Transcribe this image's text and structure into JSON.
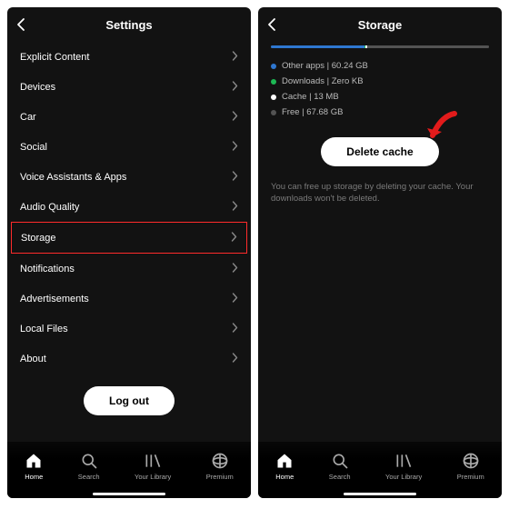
{
  "left": {
    "title": "Settings",
    "items": [
      {
        "label": "Explicit Content"
      },
      {
        "label": "Devices"
      },
      {
        "label": "Car"
      },
      {
        "label": "Social"
      },
      {
        "label": "Voice Assistants & Apps"
      },
      {
        "label": "Audio Quality"
      },
      {
        "label": "Storage",
        "highlight": true
      },
      {
        "label": "Notifications"
      },
      {
        "label": "Advertisements"
      },
      {
        "label": "Local Files"
      },
      {
        "label": "About"
      }
    ],
    "logout_label": "Log out"
  },
  "right": {
    "title": "Storage",
    "segments": [
      {
        "color": "#2e77d0",
        "pct": 43
      },
      {
        "color": "#1db954",
        "pct": 0.5
      },
      {
        "color": "#ffffff",
        "pct": 0.5
      },
      {
        "color": "#535353",
        "pct": 56
      }
    ],
    "legend": [
      {
        "color": "#2e77d0",
        "label": "Other apps | 60.24 GB"
      },
      {
        "color": "#1db954",
        "label": "Downloads | Zero KB"
      },
      {
        "color": "#ffffff",
        "label": "Cache | 13 MB"
      },
      {
        "color": "#535353",
        "label": "Free | 67.68 GB"
      }
    ],
    "delete_label": "Delete cache",
    "hint": "You can free up storage by deleting your cache. Your downloads won't be deleted."
  },
  "nav": [
    {
      "label": "Home",
      "icon": "home",
      "active": true
    },
    {
      "label": "Search",
      "icon": "search"
    },
    {
      "label": "Your Library",
      "icon": "library"
    },
    {
      "label": "Premium",
      "icon": "premium"
    }
  ]
}
